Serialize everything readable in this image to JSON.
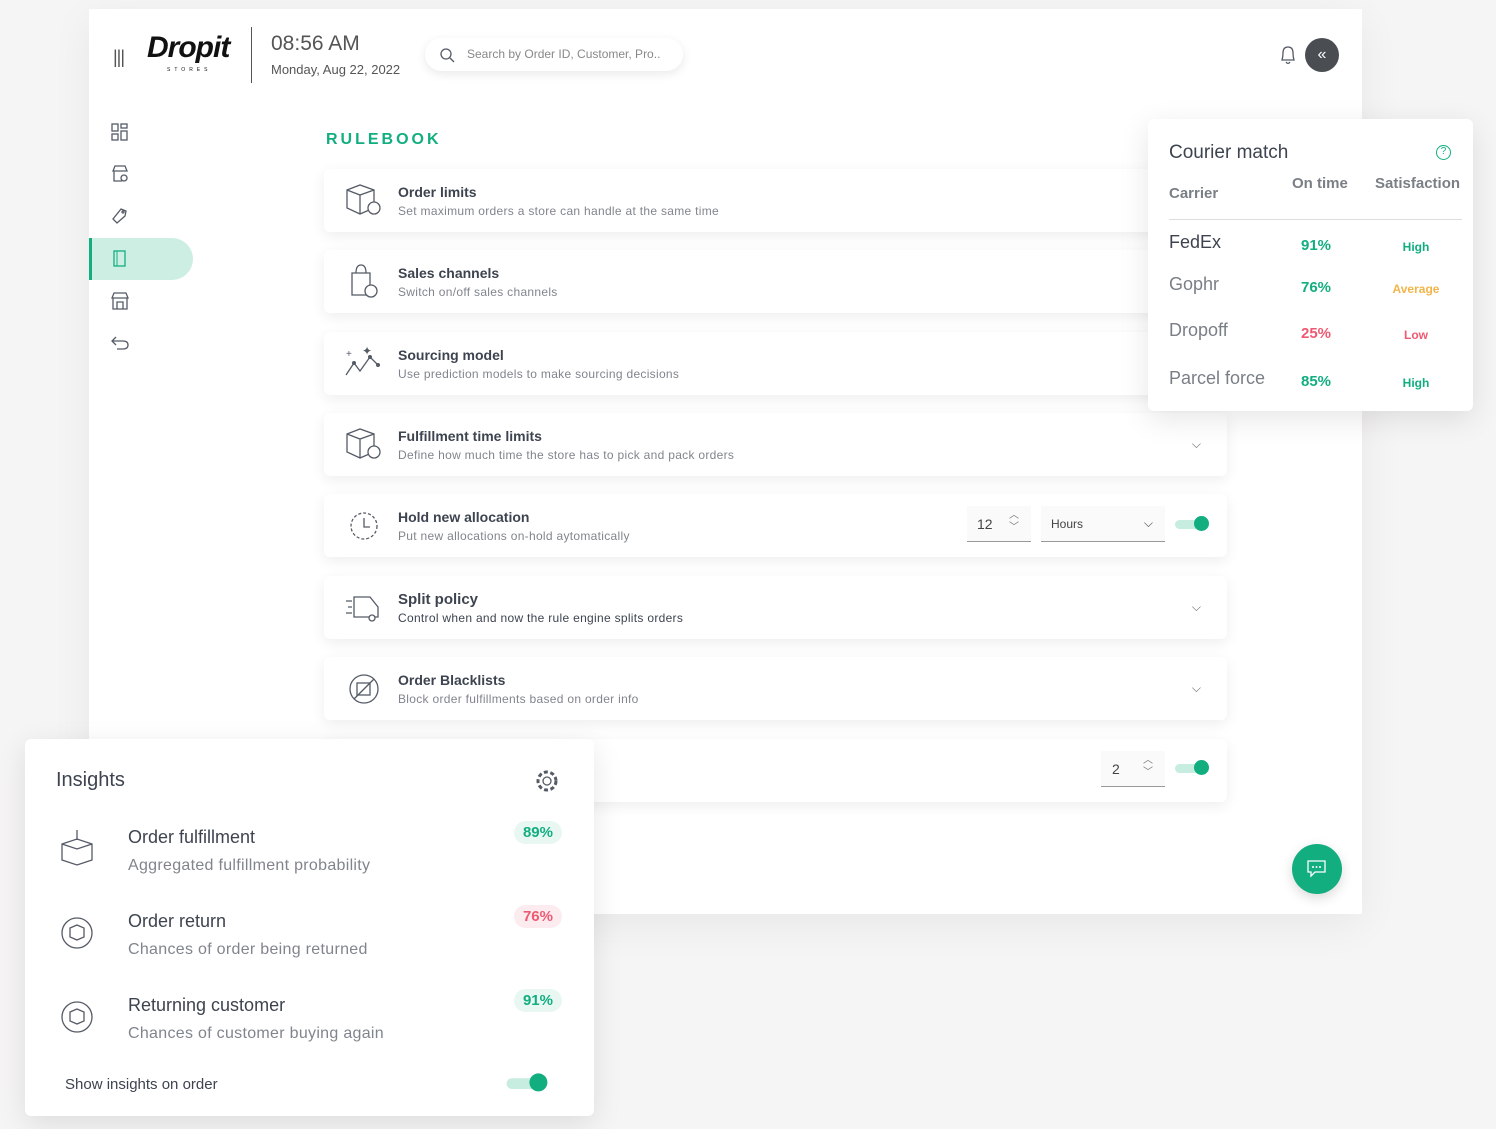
{
  "header": {
    "logo": "Dropit",
    "logo_sub": "STORES",
    "time": "08:56 AM",
    "date": "Monday, Aug 22, 2022",
    "search_placeholder": "Search by Order ID, Customer, Pro.."
  },
  "page_title": "RULEBOOK",
  "rules": [
    {
      "title": "Order limits",
      "subtitle": "Set maximum orders a store can handle at the same time"
    },
    {
      "title": "Sales channels",
      "subtitle": "Switch on/off sales channels"
    },
    {
      "title": "Sourcing model",
      "subtitle": "Use prediction models to make sourcing decisions"
    },
    {
      "title": "Fulfillment time limits",
      "subtitle": "Define how much time the store has to pick and pack orders"
    },
    {
      "title": "Hold new allocation",
      "subtitle": "Put new allocations on-hold aytomatically",
      "value": "12",
      "unit": "Hours",
      "enabled": true
    },
    {
      "title": "Split policy",
      "subtitle": "Control when and now the rule engine splits orders"
    },
    {
      "title": "Order Blacklists",
      "subtitle": "Block order fulfillments based on order info"
    },
    {
      "value": "2",
      "enabled": true
    }
  ],
  "courier": {
    "title": "Courier match",
    "headers": [
      "Carrier",
      "On time",
      "Satisfaction"
    ],
    "rows": [
      {
        "carrier": "FedEx",
        "on_time": "91%",
        "satisfaction": "High",
        "color": "#12ae80"
      },
      {
        "carrier": "Gophr",
        "on_time": "76%",
        "satisfaction": "Average",
        "color": "#f2b54a"
      },
      {
        "carrier": "Dropoff",
        "on_time": "25%",
        "satisfaction": "Low",
        "color": "#ee5a72"
      },
      {
        "carrier": "Parcel force",
        "on_time": "85%",
        "satisfaction": "High",
        "color": "#12ae80"
      }
    ]
  },
  "insights": {
    "title": "Insights",
    "items": [
      {
        "title": "Order fulfillment",
        "subtitle": "Aggregated fulfillment probability",
        "value": "89%"
      },
      {
        "title": "Order return",
        "subtitle": "Chances of order being returned",
        "value": "76%"
      },
      {
        "title": "Returning customer",
        "subtitle": "Chances of customer buying again",
        "value": "91%"
      }
    ],
    "toggle_label": "Show insights on order",
    "toggle_on": true
  }
}
